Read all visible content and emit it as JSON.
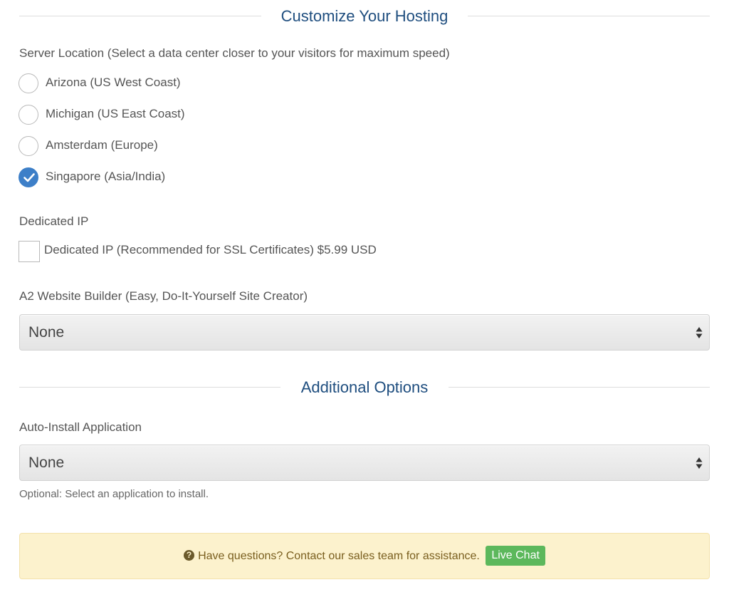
{
  "customize": {
    "title": "Customize Your Hosting"
  },
  "server_location": {
    "label": "Server Location (Select a data center closer to your visitors for maximum speed)",
    "options": [
      {
        "label": "Arizona (US West Coast)",
        "checked": false
      },
      {
        "label": "Michigan (US East Coast)",
        "checked": false
      },
      {
        "label": "Amsterdam (Europe)",
        "checked": false
      },
      {
        "label": "Singapore (Asia/India)",
        "checked": true
      }
    ]
  },
  "dedicated_ip": {
    "label": "Dedicated IP",
    "checkbox_label": "Dedicated IP (Recommended for SSL Certificates) $5.99 USD",
    "checked": false
  },
  "website_builder": {
    "label": "A2 Website Builder (Easy, Do-It-Yourself Site Creator)",
    "selected": "None"
  },
  "additional": {
    "title": "Additional Options"
  },
  "auto_install": {
    "label": "Auto-Install Application",
    "selected": "None",
    "helper": "Optional: Select an application to install."
  },
  "notice": {
    "icon": "question-circle-icon",
    "text": "Have questions? Contact our sales team for assistance.",
    "button_label": "Live Chat"
  },
  "colors": {
    "heading": "#1f4e7f",
    "radio_checked": "#3d7fc8",
    "notice_bg": "#fcf2cd",
    "live_chat": "#5cb85c"
  }
}
